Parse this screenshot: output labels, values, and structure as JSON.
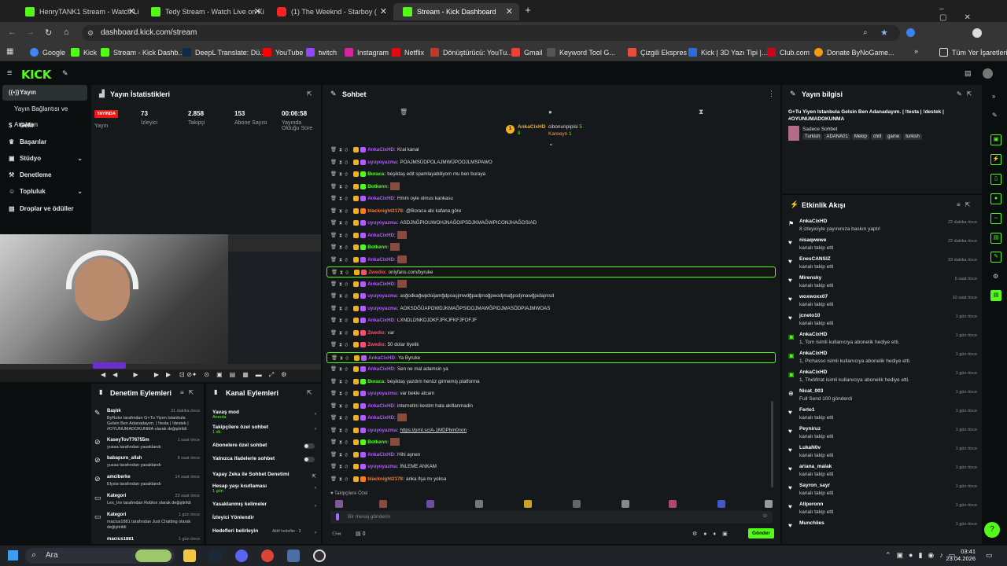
{
  "browser": {
    "tabs": [
      {
        "title": "HenryTANK1 Stream - Watch Li",
        "active": false
      },
      {
        "title": "Tedy Stream - Watch Live on Ki",
        "active": false
      },
      {
        "title": "(1) The Weeknd - Starboy (",
        "active": false
      },
      {
        "title": "Stream - Kick Dashboard",
        "active": true
      }
    ],
    "url": "dashboard.kick.com/stream",
    "bookmarks": [
      "Google",
      "Kick",
      "Stream - Kick Dashb...",
      "DeepL Translate: Dü...",
      "YouTube",
      "twitch",
      "Instagram",
      "Netflix",
      "Dönüştürücü: YouTu...",
      "Gmail",
      "Keyword Tool G...",
      "Çizgili Ekspres",
      "Kick | 3D Yazı Tipi |...",
      "Club.com",
      "Donate ByNoGame..."
    ],
    "all_bookmarks": "Tüm Yer İşaretleri"
  },
  "kick": {
    "logo": "KICK",
    "sidebar": [
      {
        "label": "Yayın",
        "icon": "broadcast-icon",
        "selected": true
      },
      {
        "label": "Yayın Bağlantısı ve Anahtarı",
        "icon": "",
        "selected": false
      },
      {
        "label": "Gelir",
        "icon": "money-icon",
        "selected": false
      },
      {
        "label": "Başarılar",
        "icon": "trophy-icon",
        "selected": false
      },
      {
        "label": "Stüdyo",
        "icon": "studio-icon",
        "selected": false
      },
      {
        "label": "Denetleme",
        "icon": "hammer-icon",
        "selected": false
      },
      {
        "label": "Topluluk",
        "icon": "community-icon",
        "selected": false
      },
      {
        "label": "Droplar ve ödüller",
        "icon": "gift-icon",
        "selected": false
      }
    ],
    "stats": {
      "title": "Yayın İstatistikleri",
      "live_badge": "YAYINDA",
      "items": [
        {
          "label": "Yayın",
          "value": ""
        },
        {
          "label": "İzleyici",
          "value": "73"
        },
        {
          "label": "Takipçi",
          "value": "2.858"
        },
        {
          "label": "Abone Sayısı",
          "value": "153"
        },
        {
          "label": "Yayında Olduğu Süre",
          "value": "00:06:58"
        }
      ]
    },
    "chat": {
      "title": "Sohbet",
      "top": [
        {
          "name": "AnkaCixHD",
          "value": "8"
        },
        {
          "name": "cibonunpipisi",
          "value": "5"
        },
        {
          "name": "Kareeyn",
          "value": "1"
        }
      ],
      "messages": [
        {
          "user": "AnkaCixHD:",
          "text": "Kral kanal",
          "color": "#b05cff",
          "hl": false
        },
        {
          "user": "uyuyoyazma:",
          "text": "POAJMSÜDPOLAJMWÜPOOJLMSPAWO",
          "color": "#b05cff",
          "hl": false
        },
        {
          "user": "Boraca:",
          "text": "beşiktaş edit spamlayabiliyom mu ben buraya",
          "color": "#53fc18",
          "hl": false
        },
        {
          "user": "Botkenn:",
          "text": "",
          "color": "#53fc18",
          "hl": false
        },
        {
          "user": "AnkaCixHD:",
          "text": "Hmm oyle olmus kankasu",
          "color": "#b05cff",
          "hl": false
        },
        {
          "user": "blacknight2178:",
          "text": "@Boraca abi kafana göre",
          "color": "#ff7a1a",
          "hl": false
        },
        {
          "user": "uyuyoyazma:",
          "text": "ASDJNĞPIOUWOHJNAĞOIPSDJKMAĞWPICONJHAĞOSIAD",
          "color": "#b05cff",
          "hl": false
        },
        {
          "user": "AnkaCixHD:",
          "text": "",
          "color": "#b05cff",
          "hl": false
        },
        {
          "user": "Botkenn:",
          "text": "",
          "color": "#53fc18",
          "hl": false
        },
        {
          "user": "AnkaCixHD:",
          "text": "",
          "color": "#b05cff",
          "hl": false
        },
        {
          "user": "Zwedio:",
          "text": "onlyfans.com/byruke",
          "color": "#ff4d6a",
          "hl": true
        },
        {
          "user": "AnkaCixHD:",
          "text": "",
          "color": "#b05cff",
          "hl": false
        },
        {
          "user": "uyuyoyazma:",
          "text": "asğodkağwpdoijamğdpoaşjmwdğpadjmağpwodjmağpsdjmawğpidajmsd",
          "color": "#b05cff",
          "hl": false
        },
        {
          "user": "uyuyoyazma:",
          "text": "AOKSDĞÜAPOWDJKMAĞPSIDOJMAWĞPIDJMASÖDPIAJMWOAS",
          "color": "#b05cff",
          "hl": false
        },
        {
          "user": "AnkaCixHD:",
          "text": "LXNDLDNKDJDKFJFKJFKFJFOFJF",
          "color": "#b05cff",
          "hl": false
        },
        {
          "user": "Zwedio:",
          "text": "var",
          "color": "#ff4d6a",
          "hl": false
        },
        {
          "user": "Zwedio:",
          "text": "50 dolar 6yelik",
          "color": "#ff4d6a",
          "hl": false
        },
        {
          "user": "AnkaCixHD:",
          "text": "Ya Byruke",
          "color": "#b05cff",
          "hl": true
        },
        {
          "user": "AnkaCixHD:",
          "text": "Sen ne mal adamsin ya",
          "color": "#b05cff",
          "hl": false
        },
        {
          "user": "Boraca:",
          "text": "beşiktaş yazdım henüz girmemiş platforma",
          "color": "#53fc18",
          "hl": false
        },
        {
          "user": "uyuyoyazma:",
          "text": "var bekle atcam",
          "color": "#b05cff",
          "hl": false
        },
        {
          "user": "AnkaCixHD:",
          "text": "internetini kestim hala akillanmadin",
          "color": "#b05cff",
          "hl": false
        },
        {
          "user": "AnkaCixHD:",
          "text": "",
          "color": "#b05cff",
          "hl": false
        },
        {
          "user": "uyuyoyazma:",
          "text": "https://prnt.sc/A-1MDPbm0rxm",
          "color": "#b05cff",
          "hl": false
        },
        {
          "user": "Botkenn:",
          "text": "",
          "color": "#53fc18",
          "hl": false
        },
        {
          "user": "AnkaCixHD:",
          "text": "Hihi aynen",
          "color": "#b05cff",
          "hl": false
        },
        {
          "user": "uyuyoyazma:",
          "text": "İNLEME ANKAM",
          "color": "#b05cff",
          "hl": false
        },
        {
          "user": "blacknight2178:",
          "text": "anka ifşa mı yoksa",
          "color": "#ff7a1a",
          "hl": false
        }
      ],
      "followers_only": "Takipçilere Özel",
      "placeholder": "Bir mesaj gönderin",
      "send": "Gönder",
      "viewers_count": "0"
    },
    "info": {
      "title": "Yayın bilgisi",
      "stream_title": "G+Tu Yiyen Istanbula Gelsin Ben Adanadayım. | !testa | !destek | #OYUNUMADOKUNMA",
      "category": "Sadece Sohbet",
      "tags": [
        "Turkish",
        "ADANA01",
        "Mekip",
        "chill",
        "game",
        "turkish"
      ]
    },
    "events": {
      "title": "Etkinlik Akışı",
      "items": [
        {
          "name": "AnkaCixHD",
          "sub": "8 izleyiciyle yayınınıza baskın yaptı!",
          "time": "22 dakika önce",
          "icon": "raid-icon"
        },
        {
          "name": "nisaqwewe",
          "sub": "kanalı takip etti",
          "time": "22 dakika önce",
          "icon": "heart-icon"
        },
        {
          "name": "EnesCANSIZ",
          "sub": "kanalı takip etti",
          "time": "33 dakika önce",
          "icon": "heart-icon"
        },
        {
          "name": "Mirensky",
          "sub": "kanalı takip etti",
          "time": "5 saat önce",
          "icon": "heart-icon"
        },
        {
          "name": "woxwoxx07",
          "sub": "kanalı takip etti",
          "time": "10 saat önce",
          "icon": "heart-icon"
        },
        {
          "name": "jcneto10",
          "sub": "kanalı takip etti",
          "time": "1 gün önce",
          "icon": "heart-icon"
        },
        {
          "name": "AnkaCixHD",
          "sub": "1, Tom isimli kullanıcıya abonelik hediye etti.",
          "time": "1 gün önce",
          "icon": "gift-icon"
        },
        {
          "name": "AnkaCixHD",
          "sub": "1, Pichasso isimli kullanıcıya abonelik hediye etti.",
          "time": "1 gün önce",
          "icon": "gift-icon"
        },
        {
          "name": "AnkaCixHD",
          "sub": "1, TheWrat isimli kullanıcıya abonelik hediye etti.",
          "time": "1 gün önce",
          "icon": "gift-icon"
        },
        {
          "name": "Nicat_003",
          "sub": "Full Send  100 gönderdi",
          "time": "1 gün önce",
          "icon": "kicks-icon"
        },
        {
          "name": "Ferlo1",
          "sub": "kanalı takip etti",
          "time": "1 gün önce",
          "icon": "heart-icon"
        },
        {
          "name": "Peyniruz",
          "sub": "kanalı takip etti",
          "time": "1 gün önce",
          "icon": "heart-icon"
        },
        {
          "name": "LukaN0v",
          "sub": "kanalı takip etti",
          "time": "1 gün önce",
          "icon": "heart-icon"
        },
        {
          "name": "ariana_malak",
          "sub": "kanalı takip etti",
          "time": "1 gün önce",
          "icon": "heart-icon"
        },
        {
          "name": "Sayron_sayr",
          "sub": "kanalı takip etti",
          "time": "1 gün önce",
          "icon": "heart-icon"
        },
        {
          "name": "Allperonn",
          "sub": "kanalı takip etti",
          "time": "1 gün önce",
          "icon": "heart-icon"
        },
        {
          "name": "Munchiies",
          "sub": "",
          "time": "1 gün önce",
          "icon": "heart-icon"
        }
      ]
    },
    "mod_actions": {
      "title": "Denetim Eylemleri",
      "items": [
        {
          "name": "Başlık",
          "detail": "ByRuke tarafından G+Tu Yiyen Istanbula Gelsin Ben Adanadayım. | !testa | !destek | #OYUNUMADOKUNMA olarak değiştirildi",
          "time": "31 dakika önce"
        },
        {
          "name": "KaseyTovT76755m",
          "detail": "yusaa tarafından yasaklandı",
          "time": "1 saat önce"
        },
        {
          "name": "babapuro_allah",
          "detail": "yusaa tarafından yasaklandı",
          "time": "8 saat önce"
        },
        {
          "name": "amciberke",
          "detail": "Elysia tarafından yasaklandı",
          "time": "14 saat önce"
        },
        {
          "name": "Kategori",
          "detail": "Lex_Inv tarafından Roblox olarak değiştirildi",
          "time": "23 saat önce"
        },
        {
          "name": "Kategori",
          "detail": "macius1881 tarafından Just Chatting olarak değiştirildi",
          "time": "1 gün önce"
        },
        {
          "name": "macius1881",
          "detail": "",
          "time": "1 gün önce"
        }
      ]
    },
    "channel_actions": {
      "title": "Kanal Eylemleri",
      "items": [
        {
          "label": "Yavaş mod",
          "sub": "Anında",
          "ctrl": "arrow"
        },
        {
          "label": "Takipçilere özel sohbet",
          "sub": "1 dk.",
          "ctrl": "arrow"
        },
        {
          "label": "Abonelere özel sohbet",
          "sub": "",
          "ctrl": "toggle"
        },
        {
          "label": "Yalnızca ifadelerle sohbet",
          "sub": "",
          "ctrl": "toggle"
        },
        {
          "label": "Yapay Zeka ile Sohbet Denetimi",
          "sub": "",
          "ctrl": "ext"
        },
        {
          "label": "Hesap yaşı kısıtlaması",
          "sub": "1 gün",
          "ctrl": "arrow"
        },
        {
          "label": "Yasaklanmış kelimeler",
          "sub": "",
          "ctrl": "arrow"
        },
        {
          "label": "İzleyici Yönlendir",
          "sub": "",
          "ctrl": "none"
        },
        {
          "label": "Hedefleri belirleyin",
          "sub": "",
          "ctrl": "goal",
          "goal": "Aktif hedefler - 3"
        }
      ]
    }
  },
  "taskbar": {
    "search": "Ara",
    "time": "03:41",
    "date": "23.04.2026"
  }
}
